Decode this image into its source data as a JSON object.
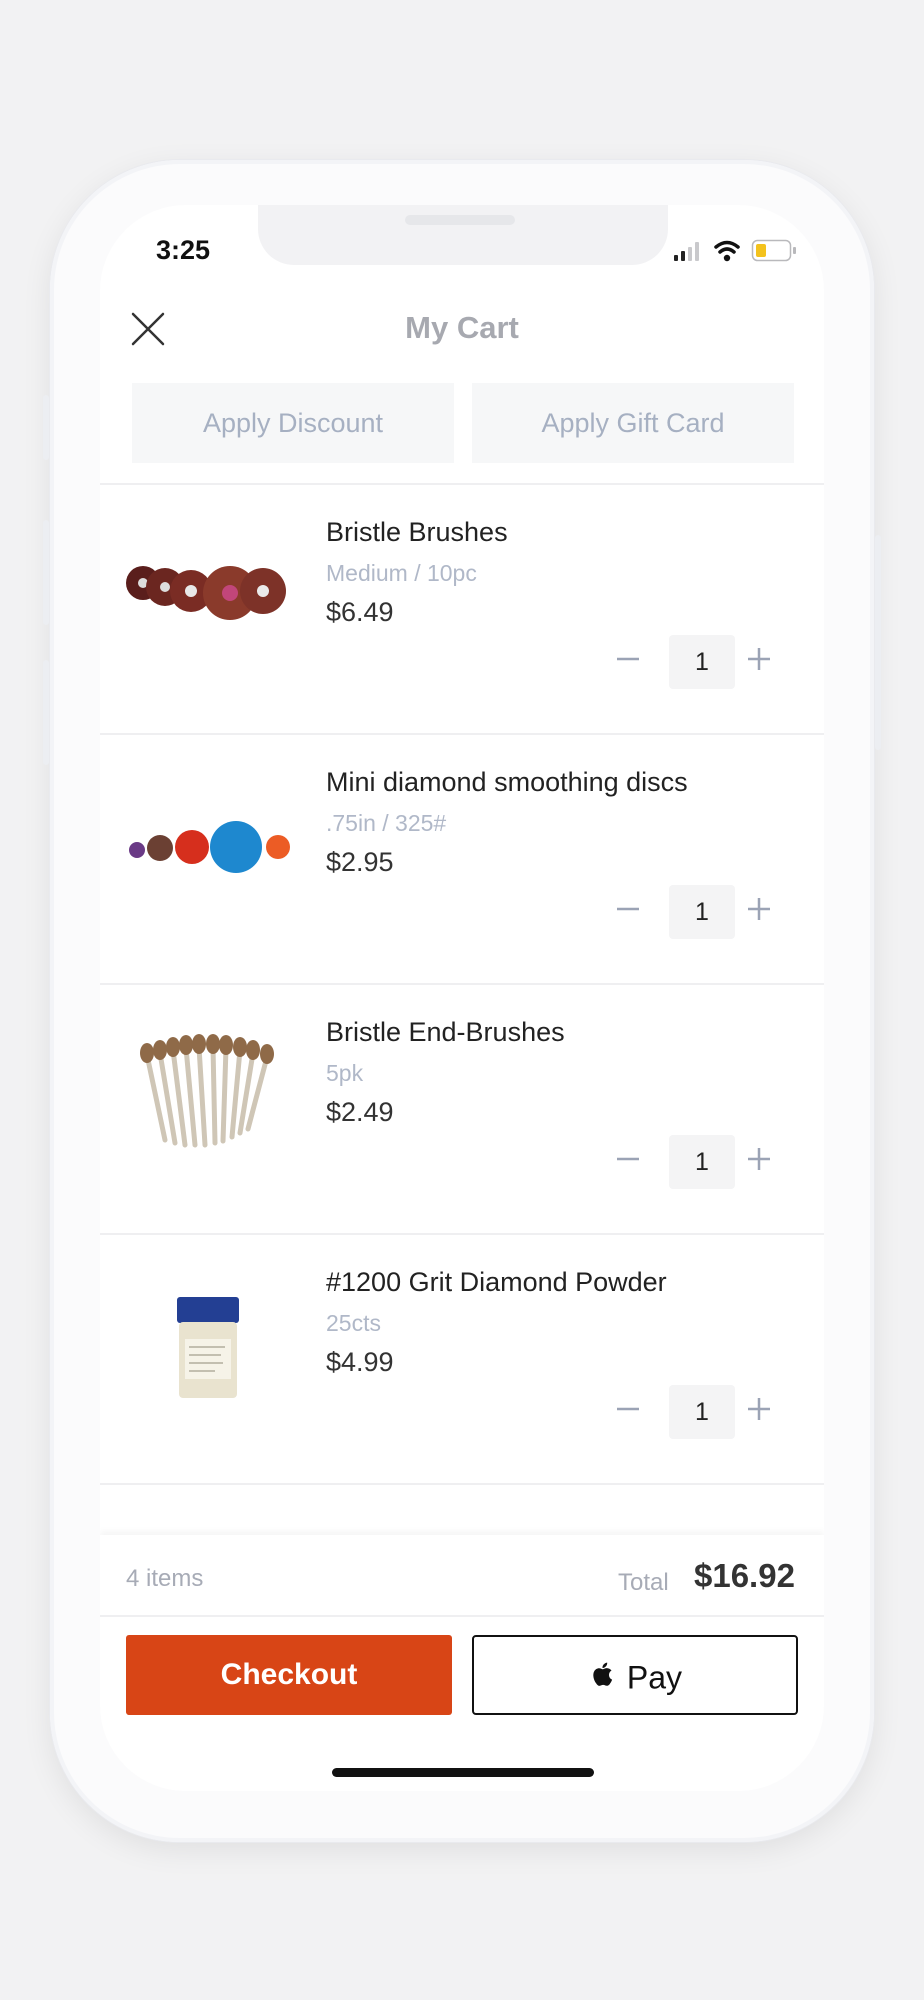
{
  "status_bar": {
    "time": "3:25"
  },
  "header": {
    "title": "My Cart"
  },
  "actions": {
    "apply_discount": "Apply Discount",
    "apply_gift_card": "Apply Gift Card"
  },
  "cart": {
    "items": [
      {
        "name": "Bristle Brushes",
        "variant": "Medium / 10pc",
        "price": "$6.49",
        "quantity": "1"
      },
      {
        "name": "Mini diamond smoothing discs",
        "variant": ".75in / 325#",
        "price": "$2.95",
        "quantity": "1"
      },
      {
        "name": "Bristle End-Brushes",
        "variant": "5pk",
        "price": "$2.49",
        "quantity": "1"
      },
      {
        "name": "#1200 Grit Diamond Powder",
        "variant": "25cts",
        "price": "$4.99",
        "quantity": "1"
      }
    ]
  },
  "footer": {
    "items_count": "4 items",
    "total_label": "Total",
    "total_value": "$16.92",
    "checkout_label": "Checkout",
    "applepay_label": "Pay"
  },
  "colors": {
    "accent": "#d84516",
    "muted_text": "#b0b8c8"
  }
}
